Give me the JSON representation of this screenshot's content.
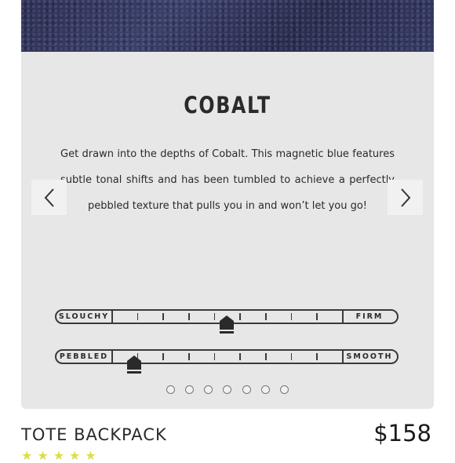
{
  "color_panel": {
    "title": "COBALT",
    "description": "Get drawn into the depths of Cobalt. This magnetic blue features subtle tonal shifts and has been tumbled to achieve a perfectly pebbled texture that pulls you in and won’t let you go!"
  },
  "nav": {
    "prev_icon": "chevron-left-icon",
    "next_icon": "chevron-right-icon"
  },
  "scales": [
    {
      "left_label": "SLOUCHY",
      "right_label": "FIRM",
      "level_fraction": 0.5
    },
    {
      "left_label": "PEBBLED",
      "right_label": "SMOOTH",
      "level_fraction": 0.1
    }
  ],
  "pagination": {
    "count": 7,
    "active_index": -1
  },
  "product": {
    "name": "TOTE BACKPACK",
    "price": "$158",
    "rating_stars_visible": 5
  },
  "colors": {
    "leather": "#2e3157",
    "panel_background": "#e7e7e7",
    "text": "#2a2a2a",
    "star": "#d9df4a"
  }
}
